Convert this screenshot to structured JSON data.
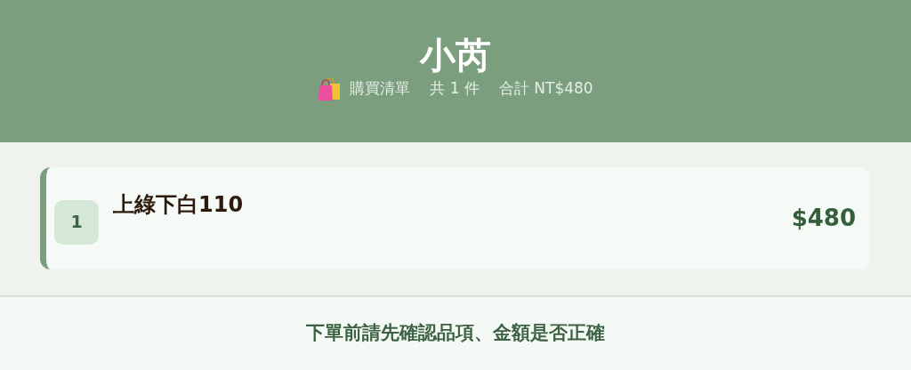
{
  "header": {
    "title": "小芮",
    "subtitle": [
      {
        "kind": "icon"
      },
      {
        "kind": "text",
        "text": "購買清單"
      },
      {
        "kind": "text",
        "text": "共 1 件"
      },
      {
        "kind": "text",
        "text": "合計 NT$480"
      }
    ]
  },
  "items": [
    {
      "index": "1",
      "name": "上綠下白110",
      "price": "$480"
    }
  ],
  "footer": {
    "note": "下單前請先確認品項、金額是否正確"
  }
}
